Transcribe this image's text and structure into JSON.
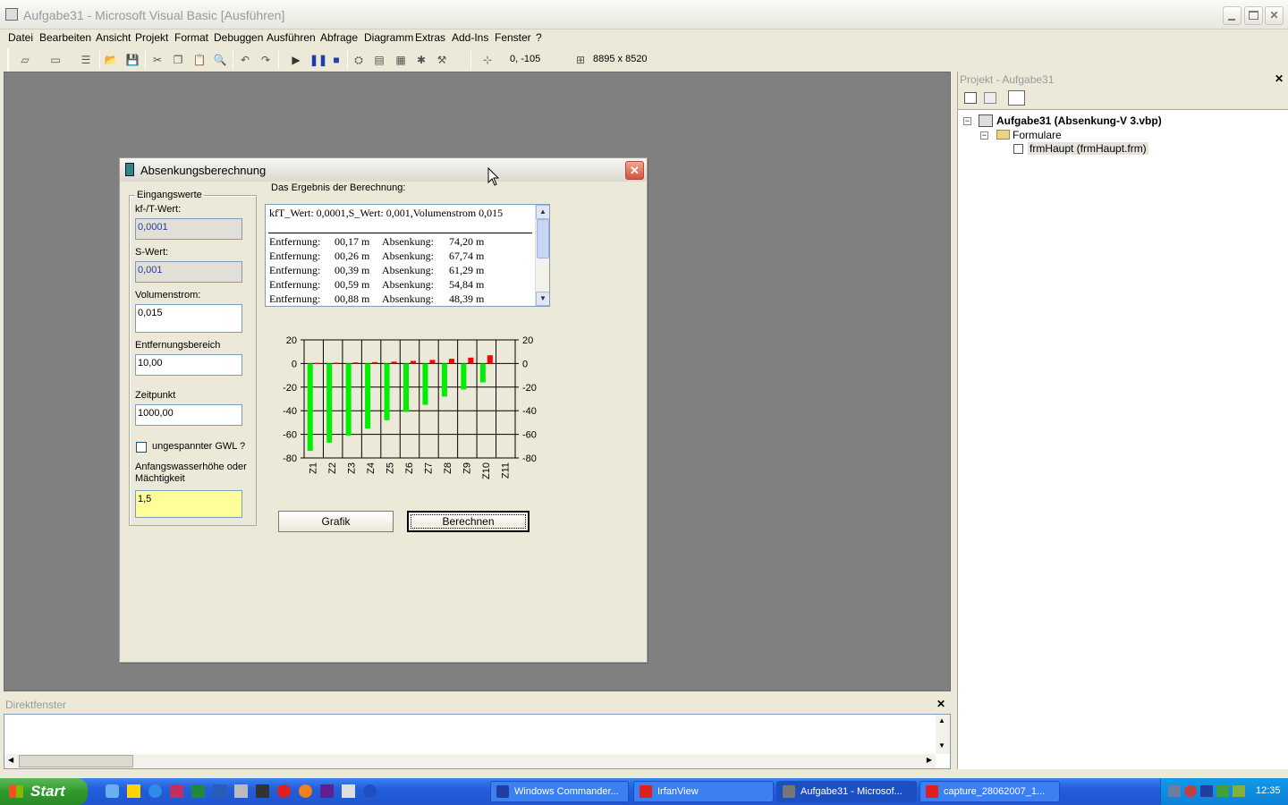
{
  "ide": {
    "title": "Aufgabe31 - Microsoft Visual Basic [Ausführen]",
    "menu": [
      "Datei",
      "Bearbeiten",
      "Ansicht",
      "Projekt",
      "Format",
      "Debuggen",
      "Ausführen",
      "Abfrage",
      "Diagramm",
      "Extras",
      "Add-Ins",
      "Fenster",
      "?"
    ],
    "toolbar": {
      "position_readout": "0, -105",
      "size_readout": "8895 x 8520"
    }
  },
  "form": {
    "title": "Absenkungsberechnung",
    "frame_label": "Eingangswerte",
    "fields": {
      "kf_label": "kf-/T-Wert:",
      "kf_value": "0,0001",
      "s_label": "S-Wert:",
      "s_value": "0,001",
      "vol_label": "Volumenstrom:",
      "vol_value": "0,015",
      "range_label": "Entfernungsbereich",
      "range_value": "10,00",
      "time_label": "Zeitpunkt",
      "time_value": "1000,00",
      "checkbox_label": "ungespannter GWL ?",
      "height_label_1": "Anfangswasserhöhe oder",
      "height_label_2": "Mächtigkeit",
      "height_value": "1,5"
    },
    "result_label": "Das Ergebnis der Berechnung:",
    "result_header": "kfT_Wert: 0,0001,S_Wert: 0,001,Volumenstrom 0,015",
    "results": [
      {
        "a": "Entfernung:",
        "d": "00,17 m",
        "b": "Absenkung:",
        "s": "74,20 m"
      },
      {
        "a": "Entfernung:",
        "d": "00,26 m",
        "b": "Absenkung:",
        "s": "67,74 m"
      },
      {
        "a": "Entfernung:",
        "d": "00,39 m",
        "b": "Absenkung:",
        "s": "61,29 m"
      },
      {
        "a": "Entfernung:",
        "d": "00,59 m",
        "b": "Absenkung:",
        "s": "54,84 m"
      },
      {
        "a": "Entfernung:",
        "d": "00,88 m",
        "b": "Absenkung:",
        "s": "48,39 m"
      }
    ],
    "buttons": {
      "grafik": "Grafik",
      "berechnen": "Berechnen"
    }
  },
  "chart_data": {
    "type": "bar",
    "categories": [
      "Z1",
      "Z2",
      "Z3",
      "Z4",
      "Z5",
      "Z6",
      "Z7",
      "Z8",
      "Z9",
      "Z10",
      "Z11"
    ],
    "series": [
      {
        "values": [
          -74,
          -67,
          -61,
          -55,
          -48,
          -41,
          -35,
          -28,
          -22,
          -16,
          0
        ],
        "color": "#00ee00"
      },
      {
        "values": [
          0.5,
          0.7,
          0.9,
          1.2,
          1.6,
          2.2,
          3,
          4,
          5,
          7,
          0
        ],
        "color": "#ff0000"
      }
    ],
    "ylim": [
      -80,
      20
    ],
    "yticks": [
      "20",
      "0",
      "-20",
      "-40",
      "-60",
      "-80"
    ],
    "grid": true
  },
  "project": {
    "title": "Projekt - Aufgabe31",
    "root": "Aufgabe31 (Absenkung-V 3.vbp)",
    "folder": "Formulare",
    "file": "frmHaupt (frmHaupt.frm)"
  },
  "immediate": {
    "title": "Direktfenster"
  },
  "taskbar": {
    "start": "Start",
    "tasks": [
      "Windows Commander...",
      "IrfanView",
      "Aufgabe31 - Microsof...",
      "capture_28062007_1..."
    ],
    "clock": "12:35"
  }
}
